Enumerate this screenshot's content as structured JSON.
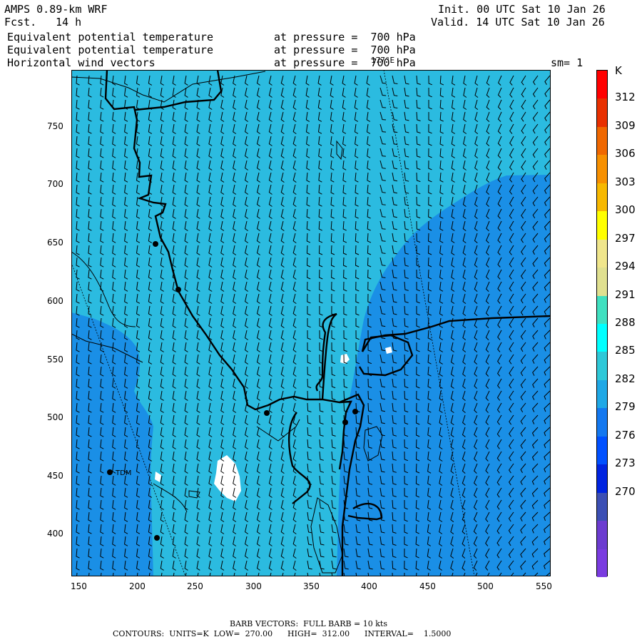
{
  "header": {
    "model": "AMPS 0.89-km WRF",
    "fcst_label": "Fcst.",
    "fcst_value": "14 h",
    "init": "Init. 00 UTC Sat 10 Jan 26",
    "valid": "Valid. 14 UTC Sat 10 Jan 26",
    "lines": [
      {
        "field": "Equivalent potential temperature",
        "level": "at pressure =  700 hPa"
      },
      {
        "field": "Equivalent potential temperature",
        "level": "at pressure =  700 hPa"
      },
      {
        "field": "Horizontal wind vectors",
        "level": "at pressure =  700 hPa"
      }
    ],
    "lon_marker": "177°E",
    "sm": "sm= 1"
  },
  "axes": {
    "x_ticks": [
      "150",
      "200",
      "250",
      "300",
      "350",
      "400",
      "450",
      "500",
      "550"
    ],
    "y_ticks": [
      "750",
      "700",
      "650",
      "600",
      "550",
      "500",
      "450",
      "400"
    ]
  },
  "colorbar": {
    "unit": "K",
    "labels": [
      "312",
      "309",
      "306",
      "303",
      "300",
      "297",
      "294",
      "291",
      "288",
      "285",
      "282",
      "279",
      "276",
      "273",
      "270"
    ],
    "colors": [
      "#ff0000",
      "#e83000",
      "#f06800",
      "#f79000",
      "#f7b800",
      "#ffff00",
      "#f0e68c",
      "#e0e090",
      "#40e0c0",
      "#00ffff",
      "#2ec8d8",
      "#1fa8e6",
      "#1478f0",
      "#0050ff",
      "#0024e0",
      "#3c4fb4",
      "#6c3cd0",
      "#7a3ce0"
    ]
  },
  "places": [
    {
      "name": "TDM"
    }
  ],
  "footer": {
    "barb": "BARB VECTORS:  FULL BARB = 10 kts",
    "contours": "CONTOURS:  UNITS=K  LOW=  270.00      HIGH=  312.00      INTERVAL=    1.5000"
  },
  "colors": {
    "region_light": "#2bbbe0",
    "region_dark": "#1a8fe6",
    "missing": "#ffffff"
  }
}
